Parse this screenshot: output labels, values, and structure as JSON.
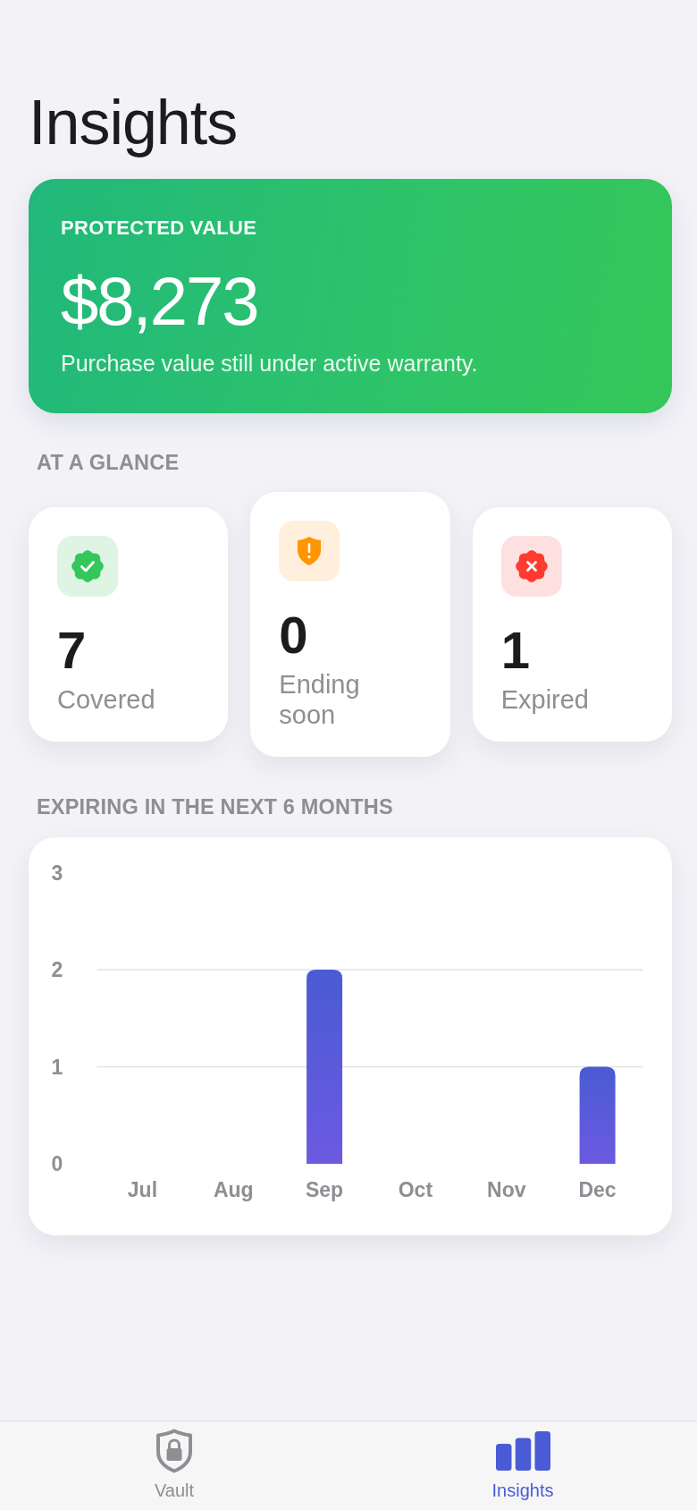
{
  "title": "Insights",
  "protected_value": {
    "label": "PROTECTED VALUE",
    "amount": "$8,273",
    "caption": "Purchase value still under active warranty."
  },
  "at_a_glance": {
    "heading": "AT A GLANCE",
    "stats": [
      {
        "kind": "covered",
        "value": "7",
        "label": "Covered"
      },
      {
        "kind": "ending",
        "value": "0",
        "label": "Ending soon"
      },
      {
        "kind": "expired",
        "value": "1",
        "label": "Expired"
      }
    ]
  },
  "expiring": {
    "heading": "EXPIRING IN THE NEXT 6 MONTHS",
    "chart_data": {
      "type": "bar",
      "categories": [
        "Jul",
        "Aug",
        "Sep",
        "Oct",
        "Nov",
        "Dec"
      ],
      "values": [
        0,
        0,
        2,
        0,
        0,
        1
      ],
      "ylim": [
        0,
        3
      ],
      "yticks": [
        0,
        1,
        2,
        3
      ]
    }
  },
  "tab_bar": {
    "tabs": [
      {
        "label": "Vault",
        "selected": false
      },
      {
        "label": "Insights",
        "selected": true
      }
    ]
  }
}
